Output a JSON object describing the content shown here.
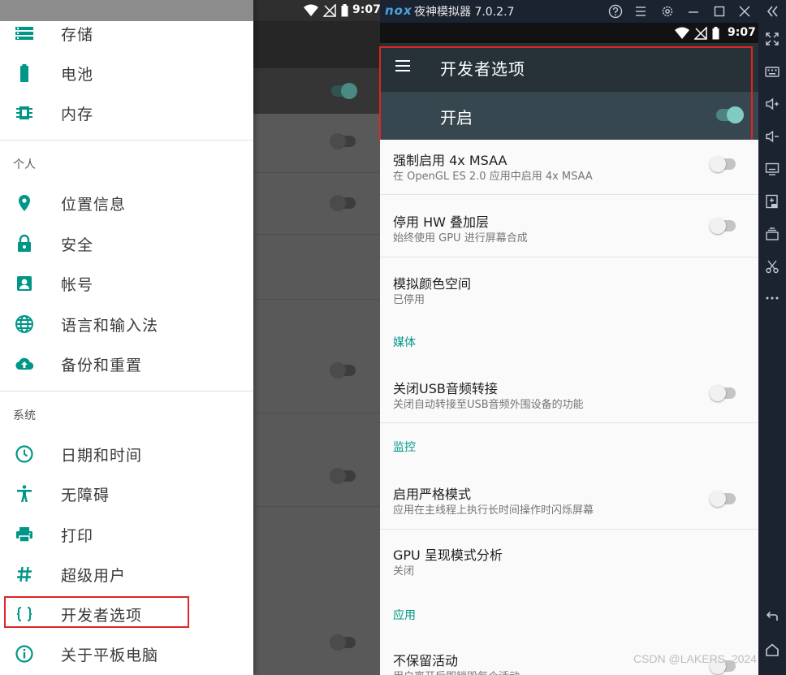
{
  "left": {
    "status_time": "9:07",
    "drawer": {
      "device_items": [
        {
          "label": "存储",
          "icon": "storage-icon"
        },
        {
          "label": "电池",
          "icon": "battery-icon"
        },
        {
          "label": "内存",
          "icon": "memory-icon"
        }
      ],
      "personal_header": "个人",
      "personal_items": [
        {
          "label": "位置信息",
          "icon": "location-icon"
        },
        {
          "label": "安全",
          "icon": "lock-icon"
        },
        {
          "label": "帐号",
          "icon": "account-icon"
        },
        {
          "label": "语言和输入法",
          "icon": "globe-icon"
        },
        {
          "label": "备份和重置",
          "icon": "cloud-upload-icon"
        }
      ],
      "system_header": "系统",
      "system_items": [
        {
          "label": "日期和时间",
          "icon": "clock-icon"
        },
        {
          "label": "无障碍",
          "icon": "accessibility-icon"
        },
        {
          "label": "打印",
          "icon": "print-icon"
        },
        {
          "label": "超级用户",
          "icon": "hash-icon"
        },
        {
          "label": "开发者选项",
          "icon": "braces-icon"
        },
        {
          "label": "关于平板电脑",
          "icon": "info-icon"
        }
      ]
    }
  },
  "emulator": {
    "logo": "nox",
    "title": "夜神模拟器 7.0.2.7",
    "status_time": "9:07"
  },
  "developer": {
    "title": "开发者选项",
    "master_label": "开启",
    "master_on": true,
    "prefs": [
      {
        "title": "强制启用 4x MSAA",
        "summary": "在 OpenGL ES 2.0 应用中启用 4x MSAA",
        "switch": false
      },
      {
        "title": "停用 HW 叠加层",
        "summary": "始终使用 GPU 进行屏幕合成",
        "switch": false
      },
      {
        "title": "模拟颜色空间",
        "summary": "已停用"
      },
      {
        "category": "媒体"
      },
      {
        "title": "关闭USB音频转接",
        "summary": "关闭自动转接至USB音频外围设备的功能",
        "switch": false
      },
      {
        "category": "监控"
      },
      {
        "title": "启用严格模式",
        "summary": "应用在主线程上执行长时间操作时闪烁屏幕",
        "switch": false
      },
      {
        "title": "GPU 呈现模式分析",
        "summary": "关闭"
      },
      {
        "category": "应用"
      },
      {
        "title": "不保留活动",
        "summary": "用户离开后即销毁每个活动",
        "switch": false
      }
    ]
  },
  "watermark": "CSDN @LAKERS_2024",
  "colors": {
    "accent": "#009688",
    "appbar": "#263238",
    "master": "#37474f",
    "highlight": "#e02424"
  }
}
